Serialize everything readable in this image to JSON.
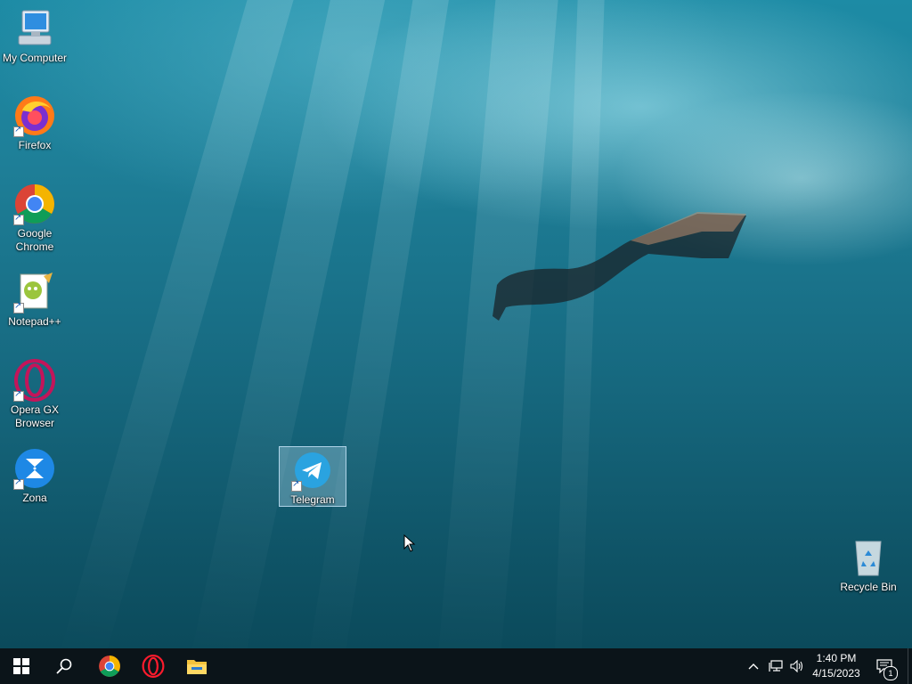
{
  "desktop": {
    "icons": [
      {
        "id": "my-computer",
        "label": "My Computer"
      },
      {
        "id": "firefox",
        "label": "Firefox"
      },
      {
        "id": "chrome",
        "label": "Google Chrome"
      },
      {
        "id": "notepadpp",
        "label": "Notepad++"
      },
      {
        "id": "opera-gx",
        "label": "Opera GX Browser"
      },
      {
        "id": "zona",
        "label": "Zona"
      },
      {
        "id": "telegram",
        "label": "Telegram"
      },
      {
        "id": "recycle-bin",
        "label": "Recycle Bin"
      }
    ],
    "selected_icon": "telegram"
  },
  "taskbar": {
    "pinned": [
      "start-icon",
      "search-icon",
      "chrome-icon",
      "opera-icon",
      "file-explorer-icon"
    ],
    "clock": {
      "time": "1:40 PM",
      "date": "4/15/2023"
    },
    "notifications_count": "1"
  },
  "colors": {
    "taskbar": "#0b1419",
    "selection": "#b4dcf0"
  }
}
